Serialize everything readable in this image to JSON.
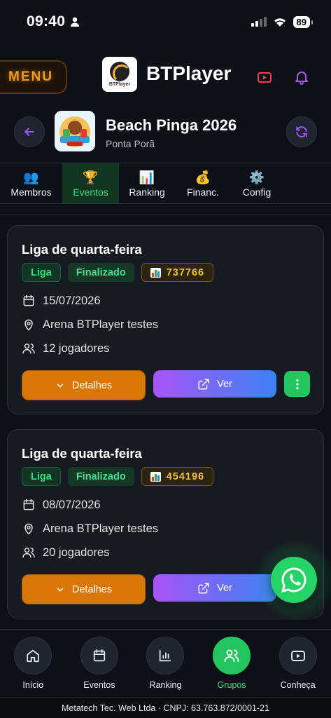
{
  "status_bar": {
    "time": "09:40",
    "battery": "89"
  },
  "header": {
    "menu_label": "MENU",
    "brand_name": "BTPlayer",
    "logo_text": "BTPlayer"
  },
  "group": {
    "title": "Beach Pinga 2026",
    "subtitle": "Ponta Porã"
  },
  "tabs": [
    {
      "icon": "👥",
      "label": "Membros",
      "active": false
    },
    {
      "icon": "🏆",
      "label": "Eventos",
      "active": true
    },
    {
      "icon": "📊",
      "label": "Ranking",
      "active": false
    },
    {
      "icon": "💰",
      "label": "Financ.",
      "active": false
    },
    {
      "icon": "⚙️",
      "label": "Config",
      "active": false
    }
  ],
  "events": [
    {
      "title": "Liga de quarta-feira",
      "type_badge": "Liga",
      "status_badge": "Finalizado",
      "score": "737766",
      "date": "15/07/2026",
      "location": "Arena BTPlayer testes",
      "players": "12 jogadores",
      "details_label": "Detalhes",
      "view_label": "Ver"
    },
    {
      "title": "Liga de quarta-feira",
      "type_badge": "Liga",
      "status_badge": "Finalizado",
      "score": "454196",
      "date": "08/07/2026",
      "location": "Arena BTPlayer testes",
      "players": "20 jogadores",
      "details_label": "Detalhes",
      "view_label": "Ver"
    }
  ],
  "bottom_nav": [
    {
      "label": "Início",
      "icon": "home-icon"
    },
    {
      "label": "Eventos",
      "icon": "calendar-icon"
    },
    {
      "label": "Ranking",
      "icon": "bar-chart-icon"
    },
    {
      "label": "Grupos",
      "icon": "users-icon",
      "active": true
    },
    {
      "label": "Conheça",
      "icon": "youtube-icon"
    }
  ],
  "footer": {
    "text": "Metatech Tec. Web Ltda · CNPJ: 63.763.872/0001-21"
  },
  "colors": {
    "accent_green": "#22c55e",
    "accent_orange": "#d97706",
    "accent_purple": "#a855f7",
    "accent_blue": "#3b82f6",
    "background": "#0d1117"
  }
}
